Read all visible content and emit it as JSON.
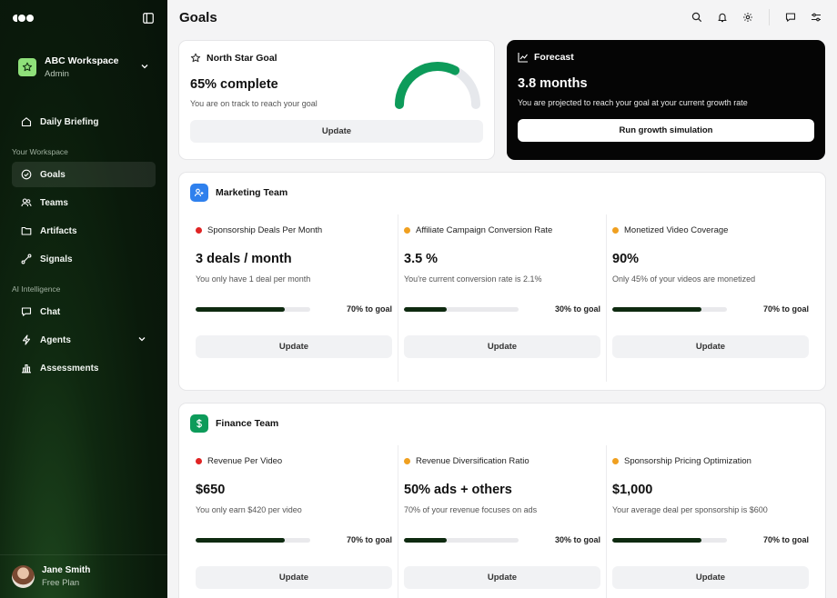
{
  "sidebar": {
    "workspace": {
      "name": "ABC Workspace",
      "role": "Admin"
    },
    "primary": [
      {
        "label": "Daily Briefing"
      }
    ],
    "section1_label": "Your Workspace",
    "workspace_items": [
      {
        "label": "Goals"
      },
      {
        "label": "Teams"
      },
      {
        "label": "Artifacts"
      },
      {
        "label": "Signals"
      }
    ],
    "section2_label": "AI Intelligence",
    "ai_items": [
      {
        "label": "Chat"
      },
      {
        "label": "Agents"
      },
      {
        "label": "Assessments"
      }
    ],
    "user": {
      "name": "Jane Smith",
      "plan": "Free Plan"
    }
  },
  "header": {
    "title": "Goals"
  },
  "north_star": {
    "title": "North Star Goal",
    "value": "65% complete",
    "subtitle": "You are on track to reach your goal",
    "button": "Update",
    "progress": 0.65,
    "accent": "#0d9b5a"
  },
  "forecast": {
    "title": "Forecast",
    "value": "3.8 months",
    "subtitle": "You are projected to reach your goal at your current growth rate",
    "button": "Run growth simulation"
  },
  "teams": [
    {
      "name": "Marketing Team",
      "badge_color": "#2f80ed",
      "icon": "users-icon",
      "metrics": [
        {
          "title": "Sponsorship Deals Per Month",
          "dot": "#e02424",
          "value": "3 deals / month",
          "subtitle": "You only have 1 deal per month",
          "goal": "70% to goal",
          "progress": 0.78,
          "button": "Update"
        },
        {
          "title": "Affiliate Campaign Conversion Rate",
          "dot": "#f0a020",
          "value": "3.5 %",
          "subtitle": "You're current conversion rate is 2.1%",
          "goal": "30% to goal",
          "progress": 0.37,
          "button": "Update"
        },
        {
          "title": "Monetized Video Coverage",
          "dot": "#f0a020",
          "value": "90%",
          "subtitle": "Only 45% of your videos are monetized",
          "goal": "70% to goal",
          "progress": 0.78,
          "button": "Update"
        }
      ]
    },
    {
      "name": "Finance Team",
      "badge_color": "#0d9b5a",
      "icon": "dollar-icon",
      "metrics": [
        {
          "title": "Revenue Per Video",
          "dot": "#e02424",
          "value": "$650",
          "subtitle": "You only earn $420 per video",
          "goal": "70% to goal",
          "progress": 0.78,
          "button": "Update"
        },
        {
          "title": "Revenue Diversification Ratio",
          "dot": "#f0a020",
          "value": "50% ads + others",
          "subtitle": "70% of your revenue focuses on ads",
          "goal": "30% to goal",
          "progress": 0.37,
          "button": "Update"
        },
        {
          "title": "Sponsorship Pricing Optimization",
          "dot": "#f0a020",
          "value": "$1,000",
          "subtitle": "Your average deal per sponsorship is $600",
          "goal": "70% to goal",
          "progress": 0.78,
          "button": "Update"
        }
      ]
    }
  ]
}
